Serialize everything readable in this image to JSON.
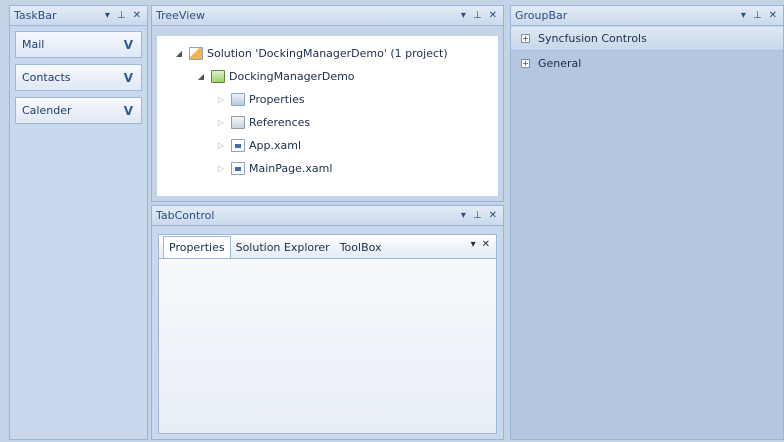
{
  "taskbar": {
    "title": "TaskBar",
    "items": [
      {
        "label": "Mail",
        "chevron": "V"
      },
      {
        "label": "Contacts",
        "chevron": "V"
      },
      {
        "label": "Calender",
        "chevron": "V"
      }
    ]
  },
  "treeview": {
    "title": "TreeView",
    "nodes": [
      {
        "label": "Solution 'DockingManagerDemo' (1 project)",
        "icon": "solution-icon"
      },
      {
        "label": "DockingManagerDemo",
        "icon": "project-icon"
      },
      {
        "label": "Properties",
        "icon": "folder-icon"
      },
      {
        "label": "References",
        "icon": "references-icon"
      },
      {
        "label": "App.xaml",
        "icon": "file-icon"
      },
      {
        "label": "MainPage.xaml",
        "icon": "file-icon"
      }
    ]
  },
  "tabcontrol": {
    "title": "TabControl",
    "tabs": [
      "Properties",
      "Solution Explorer",
      "ToolBox"
    ]
  },
  "groupbar": {
    "title": "GroupBar",
    "items": [
      "Syncfusion Controls",
      "General"
    ]
  },
  "colors": {
    "background": "#c5d3e6",
    "header": "#cad9ec",
    "groupbar_body": "#b4c6e0"
  }
}
